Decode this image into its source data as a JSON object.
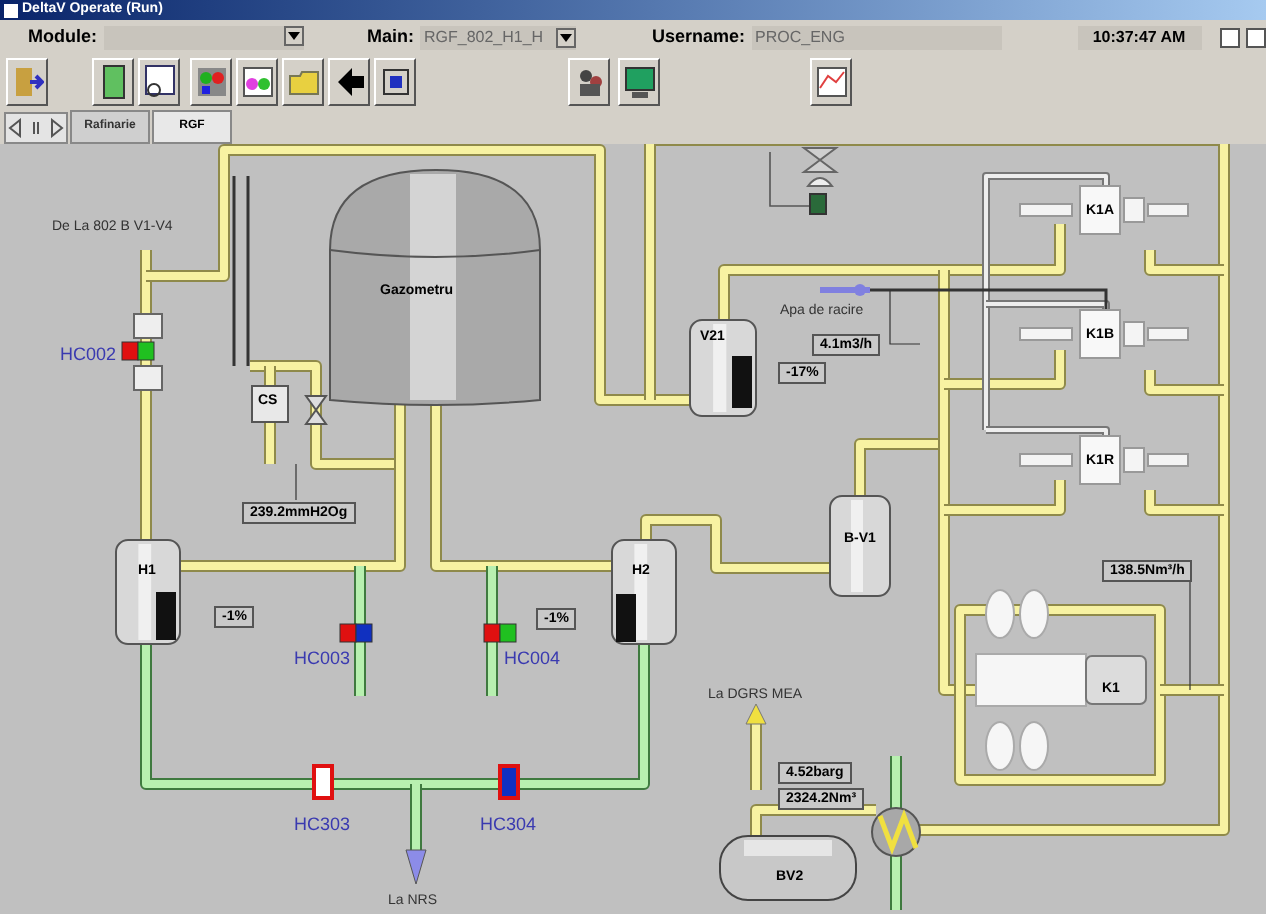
{
  "window": {
    "title": "DeltaV Operate (Run)"
  },
  "header": {
    "module_label": "Module:",
    "main_label": "Main:",
    "main_value": "RGF_802_H1_H",
    "username_label": "Username:",
    "username_value": "PROC_ENG",
    "time": "10:37:47 AM"
  },
  "tabs": [
    {
      "label": "Rafinarie",
      "selected": false
    },
    {
      "label": "RGF",
      "selected": true
    }
  ],
  "diagram": {
    "texts": [
      {
        "kind": "note",
        "text": "De La 802 B V1-V4"
      },
      {
        "kind": "tag",
        "text": "HC002"
      },
      {
        "kind": "vessel",
        "text": "Gazometru"
      },
      {
        "kind": "vessel",
        "text": "CS"
      },
      {
        "kind": "readout",
        "text": "239.2mmH2Og"
      },
      {
        "kind": "vessel",
        "text": "H1"
      },
      {
        "kind": "readout",
        "text": "-1%"
      },
      {
        "kind": "tag",
        "text": "HC003"
      },
      {
        "kind": "tag",
        "text": "HC004"
      },
      {
        "kind": "vessel",
        "text": "H2"
      },
      {
        "kind": "readout",
        "text": "-1%"
      },
      {
        "kind": "tag",
        "text": "HC303"
      },
      {
        "kind": "tag",
        "text": "HC304"
      },
      {
        "kind": "note",
        "text": "La NRS"
      },
      {
        "kind": "vessel",
        "text": "V21"
      },
      {
        "kind": "readout",
        "text": "-17%"
      },
      {
        "kind": "note",
        "text": "Apa de racire"
      },
      {
        "kind": "readout",
        "text": "4.1m3/h"
      },
      {
        "kind": "vessel",
        "text": "K1A"
      },
      {
        "kind": "vessel",
        "text": "K1B"
      },
      {
        "kind": "vessel",
        "text": "K1R"
      },
      {
        "kind": "vessel",
        "text": "B-V1"
      },
      {
        "kind": "readout",
        "text": "138.5Nm³/h"
      },
      {
        "kind": "vessel",
        "text": "K1"
      },
      {
        "kind": "note",
        "text": "La DGRS MEA"
      },
      {
        "kind": "readout",
        "text": "4.52barg"
      },
      {
        "kind": "readout",
        "text": "2324.2Nm³"
      },
      {
        "kind": "vessel",
        "text": "BV2"
      }
    ]
  }
}
